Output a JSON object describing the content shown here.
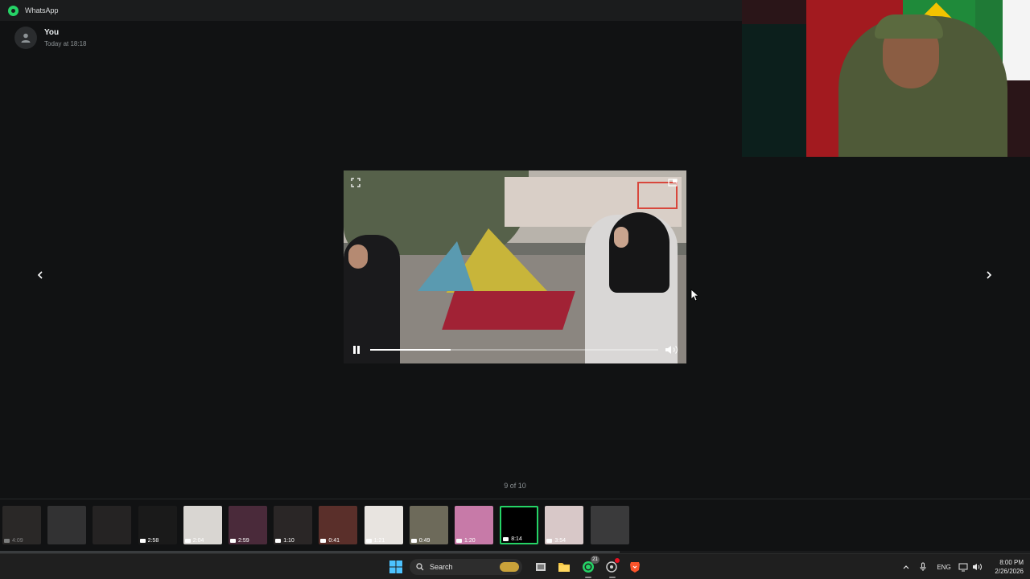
{
  "app": {
    "title": "WhatsApp"
  },
  "sender": {
    "name": "You",
    "time": "Today at 18:18"
  },
  "viewer": {
    "counter": "9 of 10",
    "playback_progress": 0.28
  },
  "thumbnails": [
    {
      "duration": "4:09",
      "dim": true
    },
    {
      "duration": "",
      "dim": true
    },
    {
      "duration": "",
      "dim": true
    },
    {
      "duration": "2:58",
      "dim": false
    },
    {
      "duration": "2:04",
      "dim": false
    },
    {
      "duration": "2:59",
      "dim": false
    },
    {
      "duration": "1:10",
      "dim": false
    },
    {
      "duration": "0:41",
      "dim": false
    },
    {
      "duration": "1:21",
      "dim": false
    },
    {
      "duration": "0:49",
      "dim": false
    },
    {
      "duration": "1:20",
      "dim": false
    },
    {
      "duration": "8:14",
      "dim": false,
      "selected": true
    },
    {
      "duration": "3:54",
      "dim": false
    },
    {
      "duration": "",
      "dim": true
    }
  ],
  "taskbar": {
    "search_label": "Search",
    "whatsapp_badge": "21",
    "language": "ENG",
    "time": "8:00 PM",
    "date": "2/26/2026"
  },
  "colors": {
    "accent": "#25d366",
    "background": "#111213"
  }
}
